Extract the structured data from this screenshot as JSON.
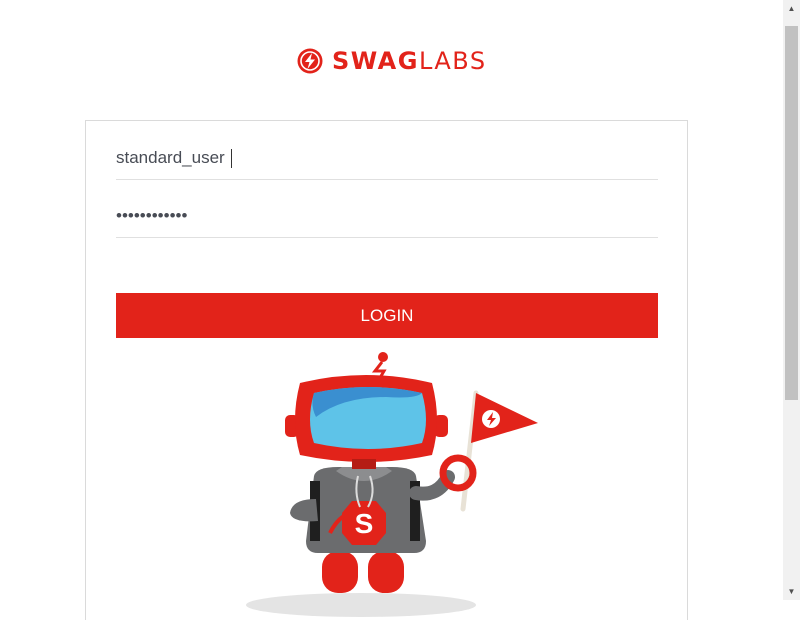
{
  "brand": {
    "name_bold": "SWAG",
    "name_light": "LABS",
    "color": "#e2231a"
  },
  "login": {
    "username_value": "standard_user",
    "password_value": "secret_sauce",
    "button_label": "LOGIN",
    "button_color": "#e2231a"
  },
  "icons": {
    "logo": "swag-labs-bolt-logo-icon",
    "mascot": "robot-mascot-with-flag",
    "scroll_up": "chevron-up-icon",
    "scroll_down": "chevron-down-icon"
  },
  "scroll": {
    "up_glyph": "▲",
    "down_glyph": "▼"
  }
}
